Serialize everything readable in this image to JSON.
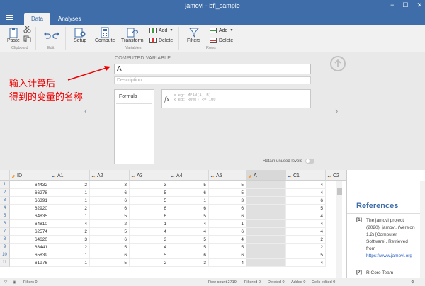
{
  "window": {
    "title": "jamovi - bfi_sample",
    "controls": [
      "−",
      "☐",
      "✕"
    ]
  },
  "tabs": [
    {
      "label": "Data"
    },
    {
      "label": "Analyses"
    }
  ],
  "ribbon": {
    "clipboard": {
      "paste": "Paste",
      "group": "Clipboard"
    },
    "edit": {
      "group": "Edit"
    },
    "variables": {
      "setup": "Setup",
      "compute": "Compute",
      "transform": "Transform",
      "add": "Add",
      "delete": "Delete",
      "group": "Variables"
    },
    "rows": {
      "filters": "Filters",
      "add": "Add",
      "delete": "Delete",
      "group": "Rows"
    }
  },
  "computed": {
    "heading": "COMPUTED VARIABLE",
    "name_value": "A",
    "description_placeholder": "Description",
    "formula_label": "Formula",
    "fx_label": "fx",
    "formula_placeholder": "= eg: MEAN(A, B)",
    "formula_placeholder_2": "x  eg: ROW() <= 100",
    "retain_label": "Retain unused levels"
  },
  "annotation": {
    "line1": "输入计算后",
    "line2": "得到的变量的名称",
    "color": "#e00000"
  },
  "grid": {
    "columns": [
      "ID",
      "A1",
      "A2",
      "A3",
      "A4",
      "A5",
      "A",
      "C1",
      "C2"
    ],
    "rows": [
      {
        "n": "1",
        "v": [
          "64432",
          "2",
          "3",
          "3",
          "5",
          "5",
          "",
          "4"
        ]
      },
      {
        "n": "2",
        "v": [
          "66278",
          "1",
          "6",
          "5",
          "6",
          "5",
          "",
          "4"
        ]
      },
      {
        "n": "3",
        "v": [
          "66391",
          "1",
          "6",
          "5",
          "1",
          "3",
          "",
          "6"
        ]
      },
      {
        "n": "4",
        "v": [
          "62920",
          "2",
          "6",
          "6",
          "6",
          "6",
          "",
          "5"
        ]
      },
      {
        "n": "5",
        "v": [
          "64835",
          "1",
          "5",
          "6",
          "5",
          "6",
          "",
          "4"
        ]
      },
      {
        "n": "6",
        "v": [
          "64810",
          "4",
          "2",
          "1",
          "4",
          "1",
          "",
          "4"
        ]
      },
      {
        "n": "7",
        "v": [
          "62574",
          "2",
          "5",
          "4",
          "4",
          "6",
          "",
          "4"
        ]
      },
      {
        "n": "8",
        "v": [
          "64620",
          "3",
          "6",
          "3",
          "5",
          "4",
          "",
          "2"
        ]
      },
      {
        "n": "9",
        "v": [
          "63441",
          "2",
          "5",
          "4",
          "5",
          "5",
          "",
          "2"
        ]
      },
      {
        "n": "10",
        "v": [
          "65839",
          "1",
          "6",
          "5",
          "6",
          "6",
          "",
          "5"
        ]
      },
      {
        "n": "11",
        "v": [
          "61976",
          "1",
          "5",
          "2",
          "3",
          "4",
          "",
          "4"
        ]
      }
    ]
  },
  "results": {
    "title": "References",
    "refs": [
      {
        "num": "[1]",
        "text": "The jamovi project (2020). jamovi. (Version 1.2) [Computer Software]. Retrieved from",
        "link": "https://www.jamovi.org"
      },
      {
        "num": "[2]",
        "text": "R Core Team"
      }
    ]
  },
  "status": {
    "row_count": "Row count 2719",
    "filtered": "Filtered 0",
    "deleted": "Deleted 0",
    "added": "Added 0",
    "cells_edited": "Cells edited 0",
    "filters": "Filters 0"
  },
  "colors": {
    "brand": "#3e6da9",
    "accent_red": "#e00000"
  }
}
